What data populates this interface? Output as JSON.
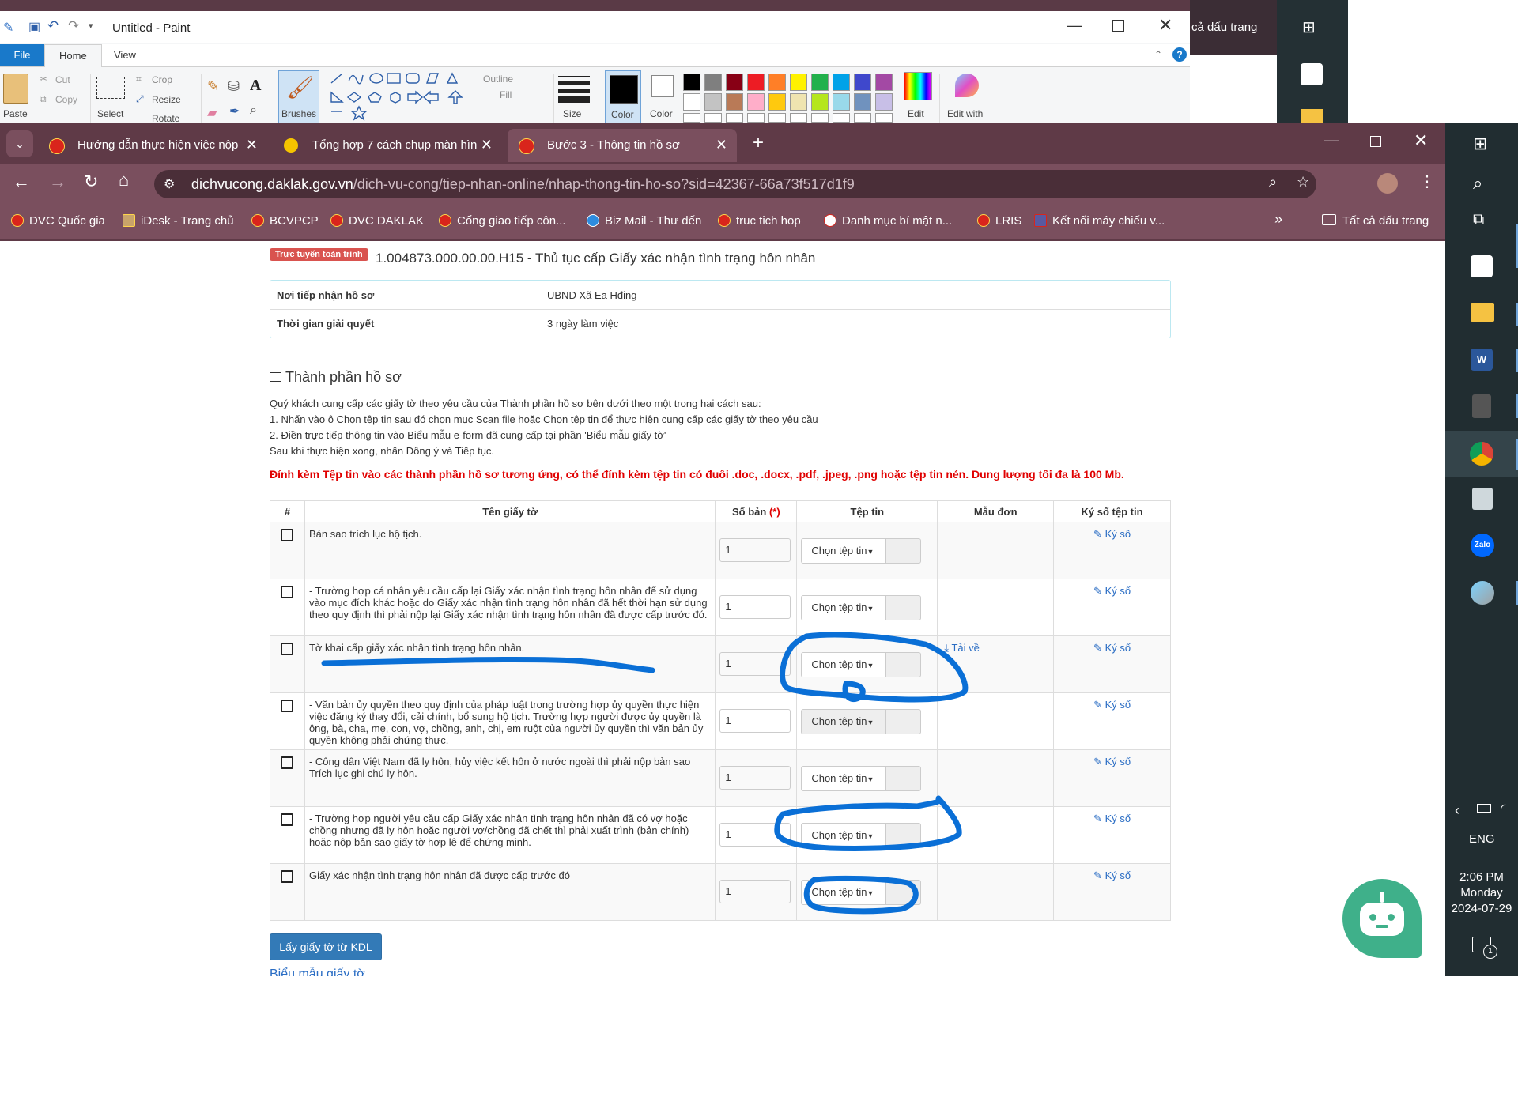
{
  "paint": {
    "title": "Untitled - Paint",
    "tabs": [
      "File",
      "Home",
      "View"
    ],
    "clipboard": {
      "paste": "Paste",
      "cut": "Cut",
      "copy": "Copy"
    },
    "image": {
      "select": "Select",
      "crop": "Crop",
      "resize": "Resize",
      "rotate": "Rotate"
    },
    "brushes": "Brushes",
    "outline": "Outline",
    "fill": "Fill",
    "size": "Size",
    "color1": "Color",
    "color2": "Color",
    "edit_colors": "Edit",
    "edit_with": "Edit with",
    "palette_row1": [
      "#000000",
      "#7f7f7f",
      "#880015",
      "#ed1c24",
      "#ff7f27",
      "#fff200",
      "#22b14c",
      "#00a2e8",
      "#3f48cc",
      "#a349a4"
    ],
    "palette_row2": [
      "#ffffff",
      "#c3c3c3",
      "#b97a57",
      "#ffaec9",
      "#ffc90e",
      "#efe4b0",
      "#b5e61d",
      "#99d9ea",
      "#7092be",
      "#c8bfe7"
    ]
  },
  "desktop_strip": {
    "bookmark_snippet": "cả dấu trang"
  },
  "chrome": {
    "tabs": [
      {
        "label": "Hướng dẫn thực hiện việc nộp l"
      },
      {
        "label": "Tổng hợp 7 cách chụp màn hình"
      },
      {
        "label": "Bước 3 - Thông tin hồ sơ"
      }
    ],
    "url_host": "dichvucong.daklak.gov.vn",
    "url_path": "/dich-vu-cong/tiep-nhan-online/nhap-thong-tin-ho-so?sid=42367-66a73f517d1f9",
    "bookmarks": [
      "DVC Quốc gia",
      "iDesk - Trang chủ",
      "BCVPCP",
      "DVC DAKLAK",
      "Cổng giao tiếp côn...",
      "Biz Mail - Thư đến",
      "truc tich hop",
      "Danh mục bí mật n...",
      "LRIS",
      "Kết nối máy chiếu v..."
    ],
    "all_bookmarks": "Tất cả dấu trang"
  },
  "page": {
    "badge": "Trực tuyến toàn trình",
    "procedure": "1.004873.000.00.00.H15 - Thủ tục cấp Giấy xác nhận tình trạng hôn nhân",
    "info": [
      {
        "label": "Nơi tiếp nhận hồ sơ",
        "value": "UBND Xã Ea Hđing"
      },
      {
        "label": "Thời gian giải quyết",
        "value": "3 ngày làm việc"
      }
    ],
    "section_title": "Thành phần hồ sơ",
    "instructions": [
      "Quý khách cung cấp các giấy tờ theo yêu cầu của Thành phần hồ sơ bên dưới theo một trong hai cách sau:",
      "1. Nhấn vào ô Chọn tệp tin sau đó chọn mục Scan file hoặc Chọn tệp tin để thực hiện cung cấp các giấy tờ theo yêu cầu",
      "2. Điền trực tiếp thông tin vào Biểu mẫu e-form đã cung cấp tại phần 'Biểu mẫu giấy tờ'",
      "Sau khi thực hiện xong, nhấn Đồng ý và Tiếp tục."
    ],
    "warning": "Đính kèm Tệp tin vào các thành phần hồ sơ tương ứng, có thể đính kèm tệp tin có đuôi .doc, .docx, .pdf, .jpeg, .png hoặc tệp tin nén. Dung lượng tối đa là 100 Mb.",
    "columns": {
      "num": "#",
      "name": "Tên giấy tờ",
      "copies": "Số bản",
      "required": "(*)",
      "file": "Tệp tin",
      "form": "Mẫu đơn",
      "sign": "Ký số tệp tin"
    },
    "rows": [
      {
        "name": "Bản sao trích lục hộ tịch.",
        "qty": "1",
        "file_btn": "Chọn tệp tin",
        "form": "",
        "sign": "Ký số"
      },
      {
        "name": "- Trường hợp cá nhân yêu cầu cấp lại Giấy xác nhận tình trạng hôn nhân để sử dụng vào mục đích khác hoặc do Giấy xác nhận tình trạng hôn nhân đã hết thời hạn sử dụng theo quy định thì phải nộp lại Giấy xác nhận tình trạng hôn nhân đã được cấp trước đó.",
        "qty": "1",
        "file_btn": "Chọn tệp tin",
        "form": "",
        "sign": "Ký số"
      },
      {
        "name": "Tờ khai cấp giấy xác nhận tình trạng hôn nhân.",
        "qty": "1",
        "file_btn": "Chọn tệp tin",
        "form": "Tải về",
        "sign": "Ký số"
      },
      {
        "name": "- Văn bản ủy quyền theo quy định của pháp luật trong trường hợp ủy quyền thực hiện việc đăng ký thay đổi, cải chính, bổ sung hộ tịch. Trường hợp người được ủy quyền là ông, bà, cha, mẹ, con, vợ, chồng, anh, chị, em ruột của người ủy quyền thì văn bản ủy quyền không phải chứng thực.",
        "qty": "1",
        "file_btn": "Chọn tệp tin",
        "form": "",
        "sign": "Ký số"
      },
      {
        "name": "- Công dân Việt Nam đã ly hôn, hủy việc kết hôn ở nước ngoài thì phải nộp bản sao Trích lục ghi chú ly hôn.",
        "qty": "1",
        "file_btn": "Chọn tệp tin",
        "form": "",
        "sign": "Ký số"
      },
      {
        "name": "- Trường hợp người yêu cầu cấp Giấy xác nhận tình trạng hôn nhân đã có vợ hoặc chồng nhưng đã ly hôn hoặc người vợ/chồng đã chết thì phải xuất trình (bản chính) hoặc nộp bản sao giấy tờ hợp lệ để chứng minh.",
        "qty": "1",
        "file_btn": "Chọn tệp tin",
        "form": "",
        "sign": "Ký số"
      },
      {
        "name": "Giấy xác nhận tình trạng hôn nhân đã được cấp trước đó",
        "qty": "1",
        "file_btn": "Chọn tệp tin",
        "form": "",
        "sign": "Ký số"
      }
    ],
    "kdl_button": "Lấy giấy tờ từ KDL",
    "next_section": "Biểu mẫu giấy tờ"
  },
  "taskbar": {
    "lang": "ENG",
    "time": "2:06 PM",
    "day": "Monday",
    "date": "2024-07-29",
    "notif_count": "1"
  },
  "colors": {
    "chrome_frame": "#5f3a47",
    "chrome_toolbar": "#7a4f5e",
    "taskbar": "#212d31",
    "link": "#2a6dc4",
    "warning": "#e00000",
    "annotation": "#0a6fd6",
    "kdl_btn": "#337ab7"
  }
}
